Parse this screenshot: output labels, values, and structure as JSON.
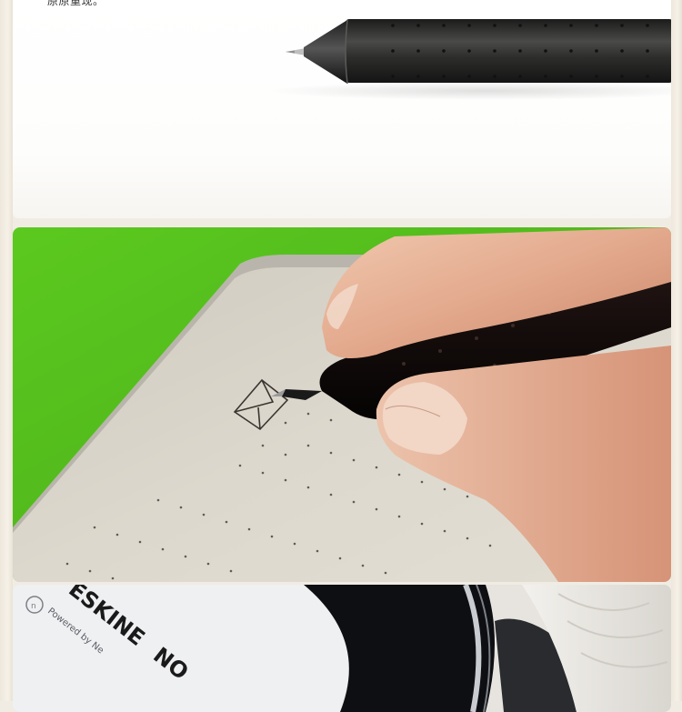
{
  "caption": "原原重现。",
  "notebook_brand": "ESKINE",
  "notebook_brand_suffix": "NO",
  "notebook_powered": "Powered by Ne",
  "colors": {
    "background": "#f1ece3",
    "green_backdrop": "#57c31c",
    "paper": "#dcd7cc",
    "pen_body": "#2c2c2c"
  }
}
